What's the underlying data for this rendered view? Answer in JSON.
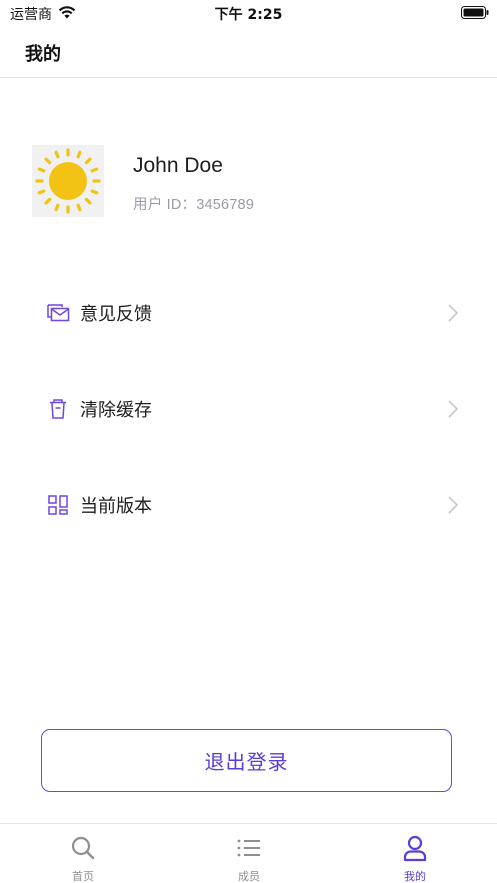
{
  "status_bar": {
    "carrier": "运营商",
    "time": "下午 2:25"
  },
  "nav": {
    "title": "我的"
  },
  "profile": {
    "name": "John Doe",
    "user_id": "用户 ID：3456789"
  },
  "menu": {
    "items": [
      {
        "label": "意见反馈",
        "icon": "mail-feedback-icon"
      },
      {
        "label": "清除缓存",
        "icon": "trash-icon"
      },
      {
        "label": "当前版本",
        "icon": "grid-icon"
      }
    ]
  },
  "logout": {
    "label": "退出登录"
  },
  "tab_bar": {
    "tabs": [
      {
        "label": "首页",
        "icon": "search-icon",
        "active": false
      },
      {
        "label": "成员",
        "icon": "list-icon",
        "active": false
      },
      {
        "label": "我的",
        "icon": "person-icon",
        "active": true
      }
    ]
  },
  "colors": {
    "accent": "#5c3bd6",
    "icon_purple": "#6b46e0",
    "inactive": "#8e8e93",
    "sun": "#f2c214"
  }
}
